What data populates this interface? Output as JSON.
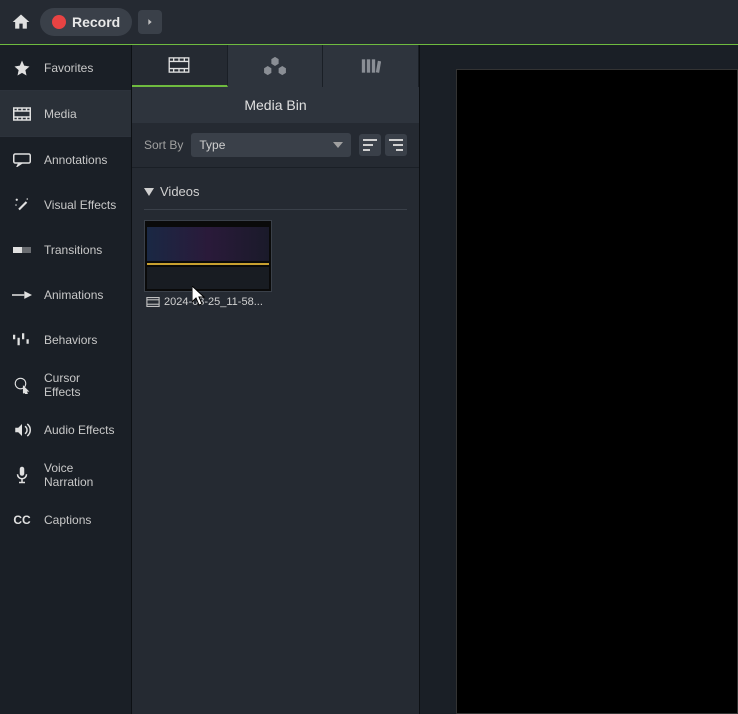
{
  "topbar": {
    "record_label": "Record"
  },
  "sidebar": {
    "items": [
      {
        "label": "Favorites",
        "icon": "star"
      },
      {
        "label": "Media",
        "icon": "film"
      },
      {
        "label": "Annotations",
        "icon": "annotation"
      },
      {
        "label": "Visual Effects",
        "icon": "wand"
      },
      {
        "label": "Transitions",
        "icon": "transition"
      },
      {
        "label": "Animations",
        "icon": "animation"
      },
      {
        "label": "Behaviors",
        "icon": "behaviors"
      },
      {
        "label": "Cursor Effects",
        "icon": "cursor"
      },
      {
        "label": "Audio Effects",
        "icon": "audio"
      },
      {
        "label": "Voice Narration",
        "icon": "mic"
      },
      {
        "label": "Captions",
        "icon": "cc"
      }
    ],
    "active_index": 1
  },
  "panel": {
    "title": "Media Bin",
    "sort_label": "Sort By",
    "sort_value": "Type",
    "section": "Videos",
    "clip_name": "2024-03-25_11-58..."
  }
}
